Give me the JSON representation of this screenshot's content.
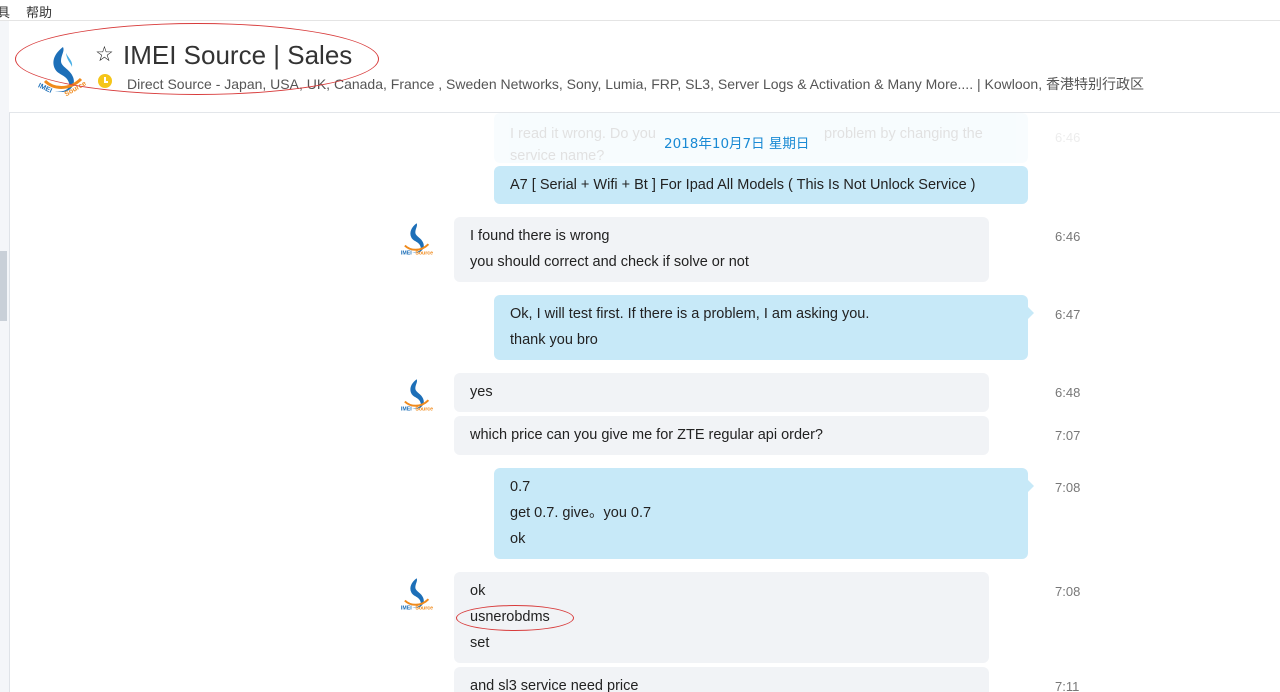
{
  "menu": {
    "item_tools_partial": "具",
    "item_help": "帮助"
  },
  "header": {
    "title": "IMEI Source | Sales",
    "subtitle": "Direct Source - Japan, USA, UK, Canada, France , Sweden Networks, Sony, Lumia, FRP, SL3, Server Logs & Activation & Many More....  |  Kowloon, 香港特别行政区",
    "logo_text": "IMEI Source"
  },
  "chat": {
    "date_banner": "2018年10月7日 星期日",
    "faded_message": {
      "lines": [
        "I read it wrong. Do you",
        "service name?"
      ],
      "tail_text": "problem by changing the",
      "time": "6:46"
    },
    "messages": [
      {
        "dir": "out",
        "lines": [
          "A7 [ Serial + Wifi + Bt ] For Ipad All Models ( This Is Not Unlock Service )"
        ],
        "time": ""
      },
      {
        "dir": "in",
        "lines": [
          "I found there is wrong",
          "you should correct and check if solve or not"
        ],
        "time": "6:46"
      },
      {
        "dir": "out",
        "lines": [
          "Ok, I will test first. If there is a problem, I am asking you.",
          "thank you bro"
        ],
        "time": "6:47"
      },
      {
        "dir": "in",
        "lines": [
          "yes"
        ],
        "time": "6:48"
      },
      {
        "dir": "in",
        "lines": [
          "which price can you give me for ZTE regular api order?"
        ],
        "time": "7:07"
      },
      {
        "dir": "out",
        "lines": [
          "0.7",
          "get 0.7. give。you 0.7",
          "ok"
        ],
        "time": "7:08"
      },
      {
        "dir": "in",
        "lines": [
          "ok",
          "usnerobdms",
          "set"
        ],
        "time": "7:08"
      },
      {
        "dir": "in",
        "lines": [
          "and sl3 service need price"
        ],
        "time": "7:11"
      }
    ]
  },
  "colors": {
    "incoming_bubble": "#f1f3f6",
    "outgoing_bubble": "#c7e9f8",
    "date_banner": "#1a8ad4",
    "annotation": "#d83b3b",
    "status_away": "#f5c518"
  },
  "icons": {
    "favorite": "star-icon",
    "status": "clock-icon",
    "avatar": "imei-source-logo"
  }
}
